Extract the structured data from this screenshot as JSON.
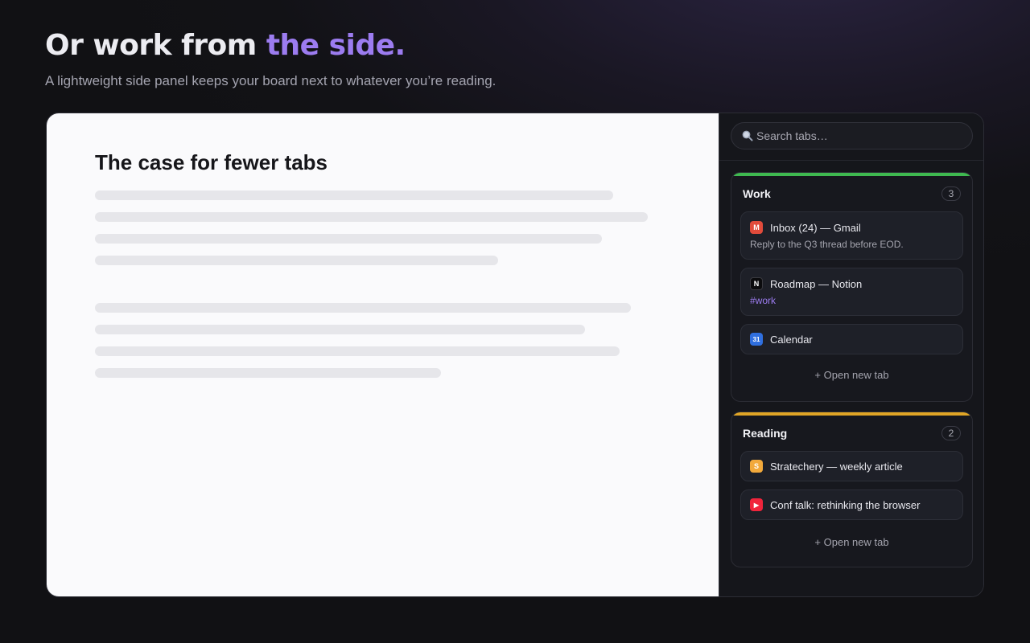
{
  "headline": {
    "prefix": "Or work from ",
    "accent": "the side.",
    "subtitle": "A lightweight side panel keeps your board next to whatever you’re reading."
  },
  "document": {
    "title": "The case for fewer tabs"
  },
  "panel": {
    "search": {
      "placeholder": "Search tabs…"
    },
    "groups": [
      {
        "name": "Work",
        "count": "3",
        "color": "#3fb950",
        "tabs": [
          {
            "favicon_icon": "gmail-icon",
            "favicon_letter": "M",
            "favicon_color": "#e14b3b",
            "title": "Inbox (24) — Gmail",
            "note": "Reply to the Q3 thread before EOD."
          },
          {
            "favicon_icon": "notion-icon",
            "favicon_letter": "N",
            "favicon_color": "#0b0b0d",
            "title": "Roadmap — Notion",
            "tag": "#work"
          },
          {
            "favicon_icon": "calendar-icon",
            "favicon_letter": "31",
            "favicon_color": "#2f6fdf",
            "title": "Calendar"
          }
        ],
        "open_new_label": "+ Open new tab"
      },
      {
        "name": "Reading",
        "count": "2",
        "color": "#e0a526",
        "tabs": [
          {
            "favicon_icon": "stratechery-icon",
            "favicon_letter": "S",
            "favicon_color": "#f2a93b",
            "title": "Stratechery — weekly article"
          },
          {
            "favicon_icon": "youtube-icon",
            "favicon_letter": "▶",
            "favicon_color": "#f0243b",
            "title": "Conf talk: rethinking the browser"
          }
        ],
        "open_new_label": "+ Open new tab"
      }
    ]
  },
  "colors": {
    "accent": "#9c7cf0",
    "work_group": "#3fb950",
    "reading_group": "#e0a526"
  }
}
